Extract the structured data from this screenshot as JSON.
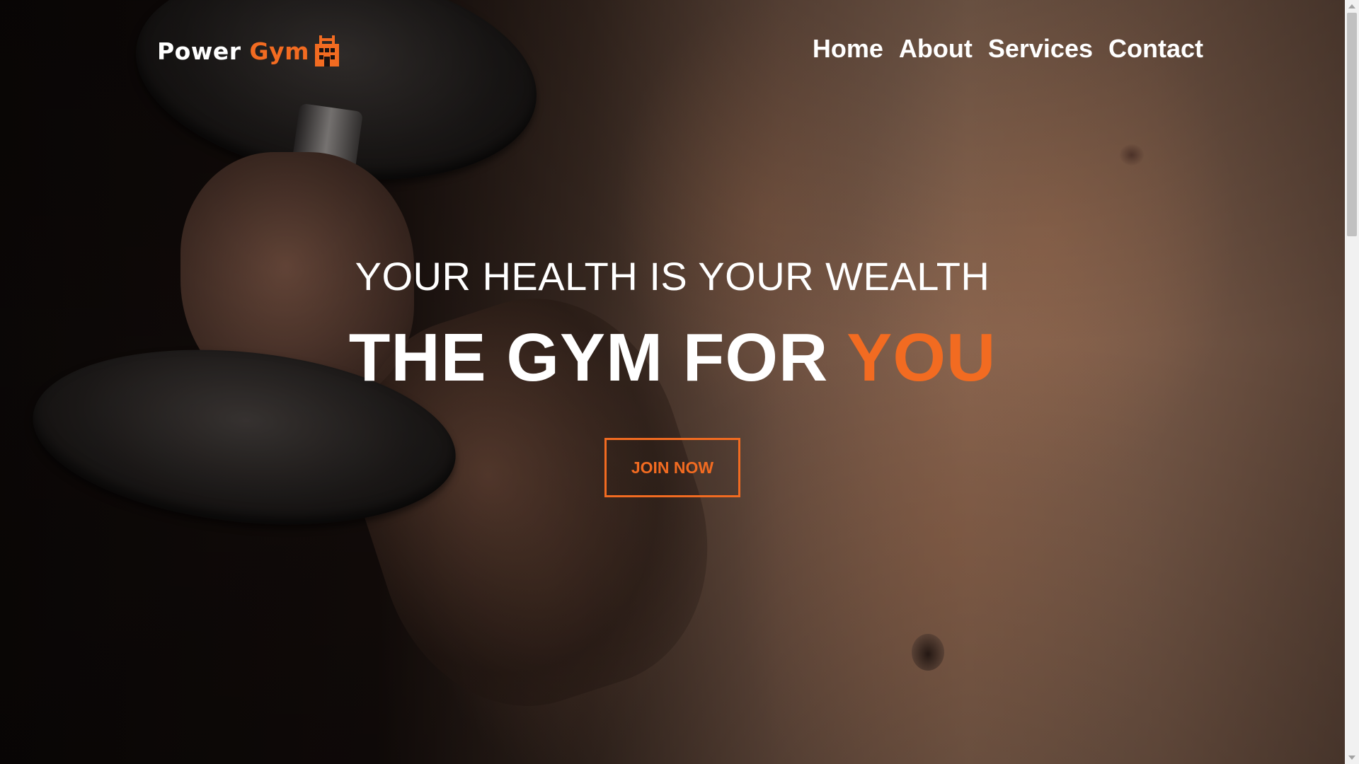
{
  "colors": {
    "accent": "#f26b21",
    "text": "#ffffff"
  },
  "header": {
    "logo": {
      "word1": "Power",
      "word2": "Gym",
      "icon": "gym-building-icon"
    },
    "nav": [
      {
        "label": "Home"
      },
      {
        "label": "About"
      },
      {
        "label": "Services"
      },
      {
        "label": "Contact"
      }
    ]
  },
  "hero": {
    "tagline": "YOUR HEALTH IS YOUR WEALTH",
    "heading_main": "THE GYM FOR ",
    "heading_accent": "YOU",
    "cta_label": "JOIN NOW",
    "background_image": "man-holding-dumbbell-photo"
  }
}
